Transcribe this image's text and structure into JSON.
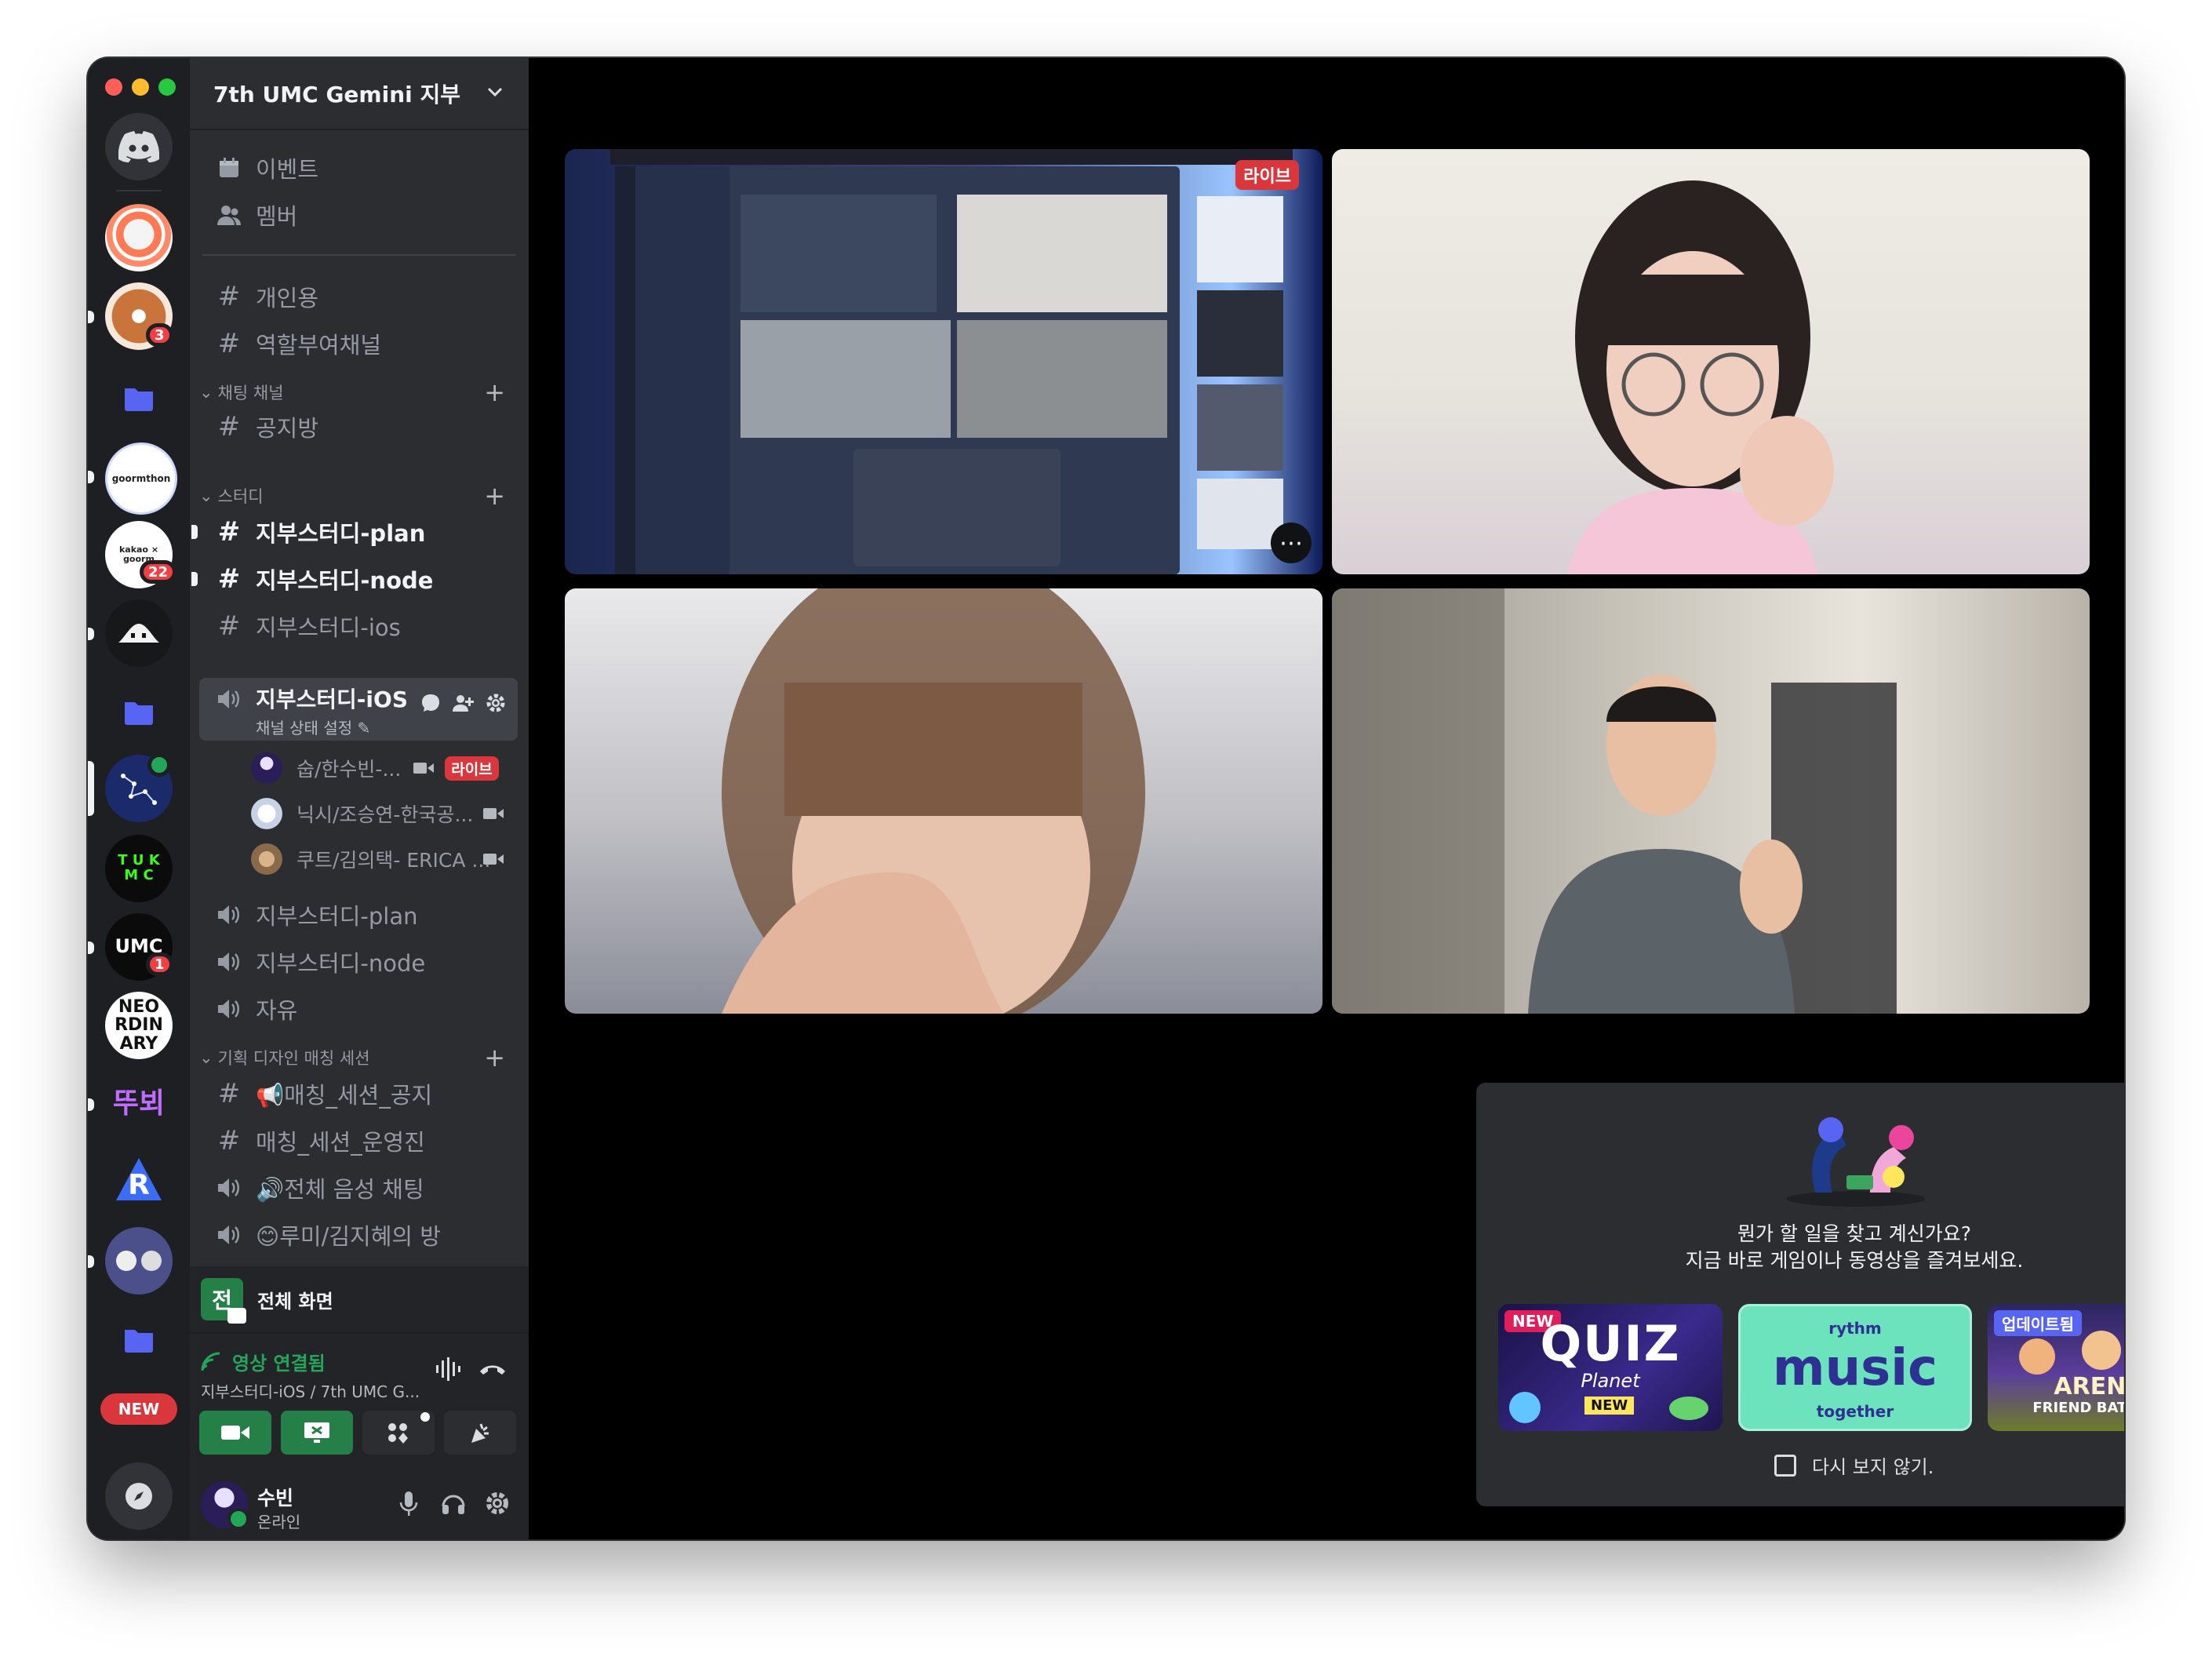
{
  "server": {
    "name": "7th UMC Gemini 지부"
  },
  "rail": {
    "badges": {
      "server2": "3",
      "server5": "22",
      "server10": "1"
    },
    "neo_text": "NEO RDIN ARY",
    "tuk_text": "T U K M C",
    "umc_text": "UMC",
    "new_label": "NEW",
    "guide_text": "뚜뵈"
  },
  "nav": {
    "events": "이벤트",
    "members": "멤버"
  },
  "channels": {
    "ch1": "개인용",
    "ch2": "역할부여채널",
    "cat_chat": "채팅 채널",
    "notice": "공지방",
    "cat_study": "스터디",
    "study_plan": "지부스터디-plan",
    "study_node": "지부스터디-node",
    "study_ios_text": "지부스터디-ios",
    "voice_ios": "지부스터디-iOS",
    "voice_ios_status": "채널 상태 설정",
    "voice_plan": "지부스터디-plan",
    "voice_node": "지부스터디-node",
    "voice_free": "자유",
    "cat_design": "기획 디자인 매칭 세션",
    "match_notice": "📢매칭_세션_공지",
    "match_ops": "매칭_세션_운영진",
    "voice_all": "🔊전체 음성 채팅",
    "voice_rumi": "😊루미/김지혜의 방"
  },
  "voice_users": [
    {
      "name": "숩/한수빈-...",
      "live": "라이브"
    },
    {
      "name": "닉시/조승연-한국공..."
    },
    {
      "name": "쿠트/김의택- ERICA ..."
    }
  ],
  "stream": {
    "avatar_letter": "전",
    "label": "전체 화면"
  },
  "connection": {
    "status": "영상 연결됨",
    "channel": "지부스터디-iOS / 7th UMC G..."
  },
  "user": {
    "name": "수빈",
    "status": "온라인"
  },
  "tiles": {
    "live_tag": "라이브"
  },
  "modal": {
    "line1": "뭔가 할 일을 찾고 계신가요?",
    "line2": "지금 바로 게임이나 동영상을 즐겨보세요.",
    "activities": [
      {
        "title": "QUIZ",
        "sub": "Planet",
        "tag": "NEW",
        "tag2": "NEW"
      },
      {
        "brand": "rythm",
        "title": "music",
        "sub": "together"
      },
      {
        "tag": "업데이트됨",
        "title": "ARENA",
        "sub": "FRIEND BATTLES"
      }
    ],
    "dont_show": "다시 보지 않기."
  },
  "colors": {
    "bg": "#000000",
    "sidebar": "#2b2d31",
    "rail": "#1e1f22",
    "live": "#da373c",
    "green": "#248046",
    "blurple": "#5865f2"
  }
}
